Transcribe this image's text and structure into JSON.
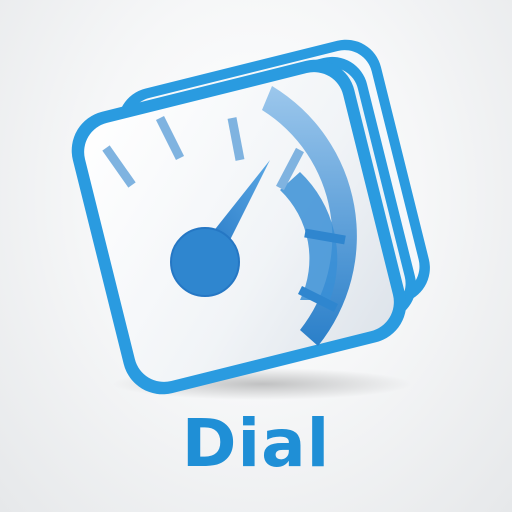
{
  "app": {
    "name": "Dial",
    "icon": "speedometer-dial-icon"
  },
  "colors": {
    "brand_blue": "#1f8fd6",
    "frame_blue": "#2a9be0",
    "gauge_blue": "#2f86cf",
    "light_blue": "#7fb8e6",
    "tick_blue": "#6aa6da",
    "background": "#f2f3f4"
  }
}
